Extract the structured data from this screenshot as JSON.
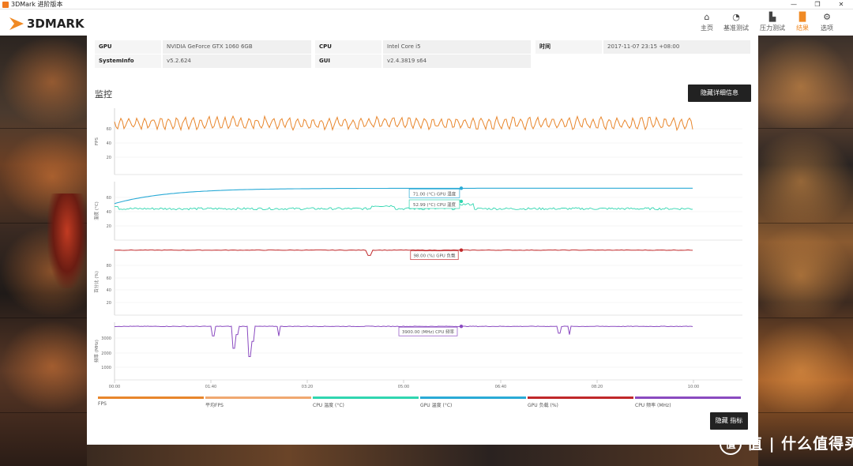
{
  "window": {
    "title": "3DMark 进阶版本",
    "controls": {
      "minimize": "—",
      "maximize": "❐",
      "close": "✕"
    }
  },
  "header": {
    "logo_text": "3DMARK",
    "nav": [
      {
        "label": "主页",
        "icon": "home-icon"
      },
      {
        "label": "基准测试",
        "icon": "gauge-icon"
      },
      {
        "label": "压力测试",
        "icon": "stress-chart-icon"
      },
      {
        "label": "结果",
        "icon": "results-bar-icon",
        "active": true
      },
      {
        "label": "选项",
        "icon": "gear-icon"
      }
    ]
  },
  "system_info": {
    "gpu_key": "GPU",
    "gpu_value": "NVIDIA GeForce GTX 1060 6GB",
    "cpu_key": "CPU",
    "cpu_value": "Intel Core i5",
    "time_key": "时间",
    "time_value": "2017-11-07 23:15 +08:00",
    "sysinfo_key": "SystemInfo",
    "sysinfo_value": "v5.2.624",
    "gui_key": "GUI",
    "gui_value": "v2.4.3819 s64"
  },
  "monitor": {
    "title": "监控",
    "hide_details_button": "隐藏详细信息",
    "hide_metrics_button": "隐藏 指标"
  },
  "chart_data": {
    "type": "line",
    "x_ticks": [
      "00:00",
      "01:40",
      "03:20",
      "05:00",
      "06:40",
      "08:20",
      "10:00"
    ],
    "panels": [
      {
        "ylabel": "FPS",
        "yticks": [
          "60",
          "40",
          "20"
        ],
        "ylim": [
          0,
          80
        ]
      },
      {
        "ylabel": "温度 (°C)",
        "yticks": [
          "60",
          "40",
          "20"
        ],
        "ylim": [
          0,
          80
        ],
        "tooltips": [
          "71.00 (°C) GPU 温度",
          "52.99 (°C) CPU 温度"
        ]
      },
      {
        "ylabel": "百分比 (%)",
        "yticks": [
          "80",
          "60",
          "40",
          "20"
        ],
        "ylim": [
          0,
          100
        ],
        "tooltips": [
          "98.00 (%) GPU 负载"
        ]
      },
      {
        "ylabel": "频率 (MHz)",
        "yticks": [
          "3000",
          "2000",
          "1000"
        ],
        "ylim": [
          0,
          4200
        ],
        "tooltips": [
          "3900.00 (MHz) CPU 频率"
        ]
      }
    ],
    "series": [
      {
        "name": "FPS",
        "color": "#e8862c",
        "approx_mean": 62
      },
      {
        "name": "平均FPS",
        "color": "#f0a870"
      },
      {
        "name": "CPU 温度 (°C)",
        "color": "#30d6b0",
        "approx_mean": 43,
        "marker_value": 52.99
      },
      {
        "name": "GPU 温度 (°C)",
        "color": "#2aaad6",
        "start": 50,
        "plateau": 71,
        "marker_value": 71.0
      },
      {
        "name": "GPU 负载 (%)",
        "color": "#c0282a",
        "approx_mean": 98,
        "marker_value": 98.0
      },
      {
        "name": "CPU 频率 (MHz)",
        "color": "#8a4ac0",
        "approx_mean": 3900,
        "marker_value": 3900.0
      }
    ]
  },
  "watermark": {
    "text": "值 | 什么值得买"
  }
}
